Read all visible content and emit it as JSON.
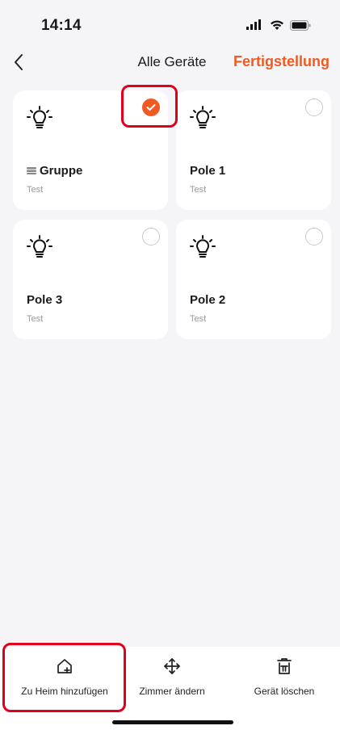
{
  "status": {
    "time": "14:14"
  },
  "nav": {
    "title": "Alle Geräte",
    "done_label": "Fertigstellung"
  },
  "devices": [
    {
      "name": "Gruppe",
      "room": "Test",
      "selected": true,
      "is_group": true
    },
    {
      "name": "Pole 1",
      "room": "Test",
      "selected": false,
      "is_group": false
    },
    {
      "name": "Pole 3",
      "room": "Test",
      "selected": false,
      "is_group": false
    },
    {
      "name": "Pole 2",
      "room": "Test",
      "selected": false,
      "is_group": false
    }
  ],
  "actions": [
    {
      "label": "Zu Heim hinzufügen",
      "icon": "home-add-icon"
    },
    {
      "label": "Zimmer ändern",
      "icon": "move-icon"
    },
    {
      "label": "Gerät löschen",
      "icon": "trash-icon"
    }
  ],
  "colors": {
    "accent": "#f05a22",
    "highlight": "#e0001b",
    "background": "#f5f5f7"
  }
}
